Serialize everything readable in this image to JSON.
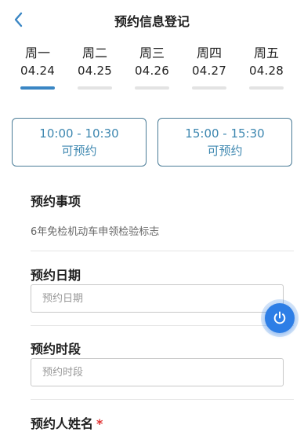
{
  "header": {
    "title": "预约信息登记"
  },
  "days": [
    {
      "weekday": "周一",
      "date": "04.24",
      "active": true
    },
    {
      "weekday": "周二",
      "date": "04.25",
      "active": false
    },
    {
      "weekday": "周三",
      "date": "04.26",
      "active": false
    },
    {
      "weekday": "周四",
      "date": "04.27",
      "active": false
    },
    {
      "weekday": "周五",
      "date": "04.28",
      "active": false
    }
  ],
  "slots": [
    {
      "time": "10:00 - 10:30",
      "status": "可预约"
    },
    {
      "time": "15:00 - 15:30",
      "status": "可预约"
    }
  ],
  "form": {
    "item_label": "预约事项",
    "item_value": "6年免检机动车申领检验标志",
    "date_label": "预约日期",
    "date_placeholder": "预约日期",
    "period_label": "预约时段",
    "period_placeholder": "预约时段",
    "name_label": "预约人姓名",
    "required_mark": "*"
  },
  "colors": {
    "accent": "#3a86c4",
    "slot_border": "#4a7c97",
    "slot_text": "#3d87b0",
    "fab": "#2d7ee6",
    "required": "#e03131"
  },
  "icons": {
    "back": "chevron-left-icon",
    "power": "power-icon"
  }
}
